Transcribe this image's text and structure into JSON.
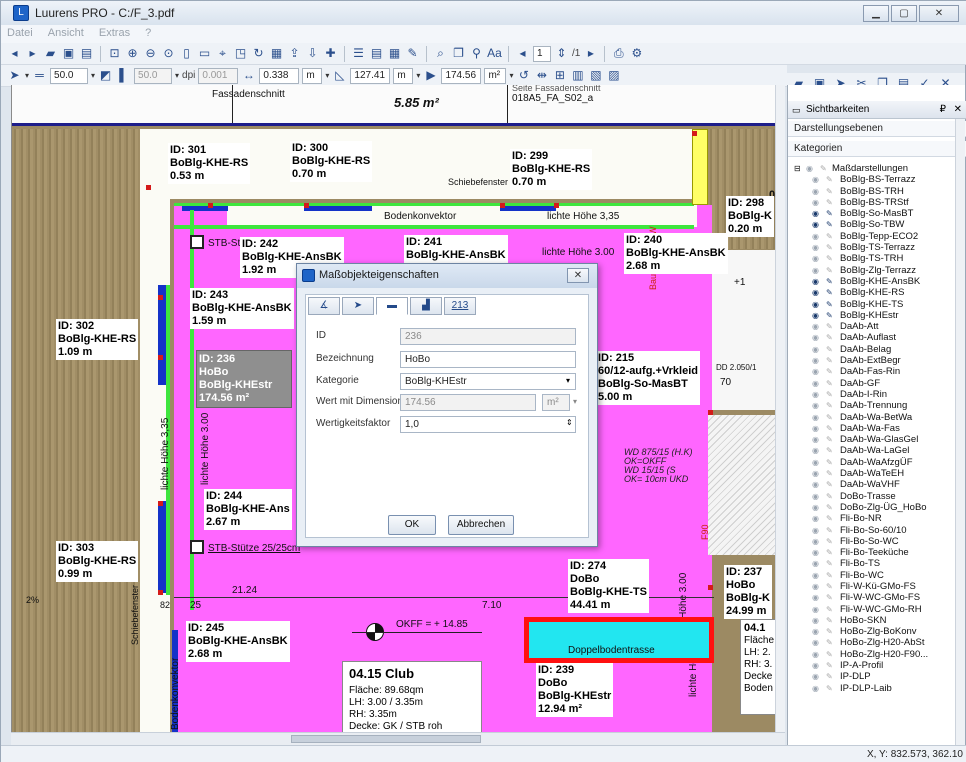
{
  "window": {
    "title": "Luurens PRO - C:/F_3.pdf",
    "min_icon": "window-minimize-icon",
    "max_icon": "window-maximize-icon",
    "close_icon": "window-close-icon"
  },
  "menu": [
    "Datei",
    "Ansicht",
    "Extras",
    "?"
  ],
  "toolbar2": {
    "page_value": "1",
    "page_total": "/1"
  },
  "toolbar3": {
    "linewidth": "50.0",
    "linewidth2": "50.0",
    "dpi_label": "dpi",
    "dpi_value": "0.001",
    "length_value": "0.338",
    "length_unit": "m",
    "area_value": "127.41",
    "area_unit": "m",
    "total_value": "174.56",
    "total_unit": "m²"
  },
  "drawing": {
    "header_left": "Fassadenschnitt",
    "header_mid": "5.85 m²",
    "header_right": "018A5_FA_S02_a",
    "header_right_top": "Seite Fassadenschnitt",
    "labels": [
      {
        "id": "ID: 301",
        "name": "BoBlg-KHE-RS",
        "value": "0.53 m"
      },
      {
        "id": "ID: 300",
        "name": "BoBlg-KHE-RS",
        "value": "0.70 m"
      },
      {
        "id": "ID: 299",
        "name": "BoBlg-KHE-RS",
        "value": "0.70 m"
      },
      {
        "id": "ID: 298",
        "name": "BoBlg-K",
        "value": "0.20 m"
      },
      {
        "id": "ID: 242",
        "name": "BoBlg-KHE-AnsBK",
        "value": "1.92 m"
      },
      {
        "id": "ID: 241",
        "name": "BoBlg-KHE-AnsBK",
        "value": ""
      },
      {
        "id": "ID: 240",
        "name": "BoBlg-KHE-AnsBK",
        "value": "2.68 m"
      },
      {
        "id": "ID: 243",
        "name": "BoBlg-KHE-AnsBK",
        "value": "1.59 m"
      },
      {
        "id": "ID: 302",
        "name": "BoBlg-KHE-RS",
        "value": "1.09 m"
      },
      {
        "id": "ID: 215",
        "name": "60/12-aufg.+Vrkleid",
        "name2": "BoBlg-So-MasBT",
        "value": "5.00 m"
      },
      {
        "id": "ID: 244",
        "name": "BoBlg-KHE-Ans",
        "value": "2.67 m"
      },
      {
        "id": "ID: 303",
        "name": "BoBlg-KHE-RS",
        "value": "0.99 m"
      },
      {
        "id": "ID: 274",
        "name": "DoBo",
        "name2": "BoBlg-KHE-TS",
        "value": "44.41 m"
      },
      {
        "id": "ID: 237",
        "name": "HoBo",
        "name2": "BoBlg-K",
        "value": "24.99 m"
      },
      {
        "id": "ID: 245",
        "name": "BoBlg-KHE-AnsBK",
        "value": "2.68 m"
      },
      {
        "id": "ID: 239",
        "name": "DoBo",
        "name2": "BoBlg-KHEstr",
        "value": "12.94 m²"
      }
    ],
    "selected_label": {
      "id": "ID: 236",
      "name": "HoBo",
      "name2": "BoBlg-KHEstr",
      "value": "174.56 m²"
    },
    "texts": {
      "bodenkonvektor": "Bodenkonvektor",
      "lichte_hoehe_335": "lichte Höhe 3,35",
      "lichte_hoehe_300": "lichte Höhe 3.00",
      "stb_stuetze": "STB-Stütze 25/25cm",
      "stb_s": "STB-St",
      "schiebefenster": "Schiebefenster",
      "doppelboden": "Doppelbodentrasse",
      "okff": "OKFF = + 14.85",
      "dim_2124": "21.24",
      "dim_710": "7.10",
      "dim_25": "25",
      "dim_82": "82",
      "dim_2pct": "2%",
      "dim_70": "70",
      "dim_41": "+1",
      "dd": "DD 2.050/1",
      "lichte_hoehe_280": "lichte Höhe 2.80",
      "wd_note1": "WD 875/15 (H.K)",
      "wd_note2": "OK=OKFF",
      "wd_note3": "WD 15/15 (S",
      "wd_note4": "OK= 10cm UKD",
      "f90": "F90",
      "bauartner": "Bauarteiner BW",
      "room_041": "04.1",
      "flaeche_short": "Fläche",
      "lh_short": "LH: 2.",
      "rh_short": "RH: 3.",
      "decke_short": "Decke",
      "boden_short": "Boden",
      "dachs": "0"
    },
    "room": {
      "title": "04.15  Club",
      "flaeche": "Fläche: 89.68qm",
      "lh": "LH: 3.00 / 3.35m",
      "rh": "RH: 3.35m",
      "decke": "Decke: GK / STB roh"
    }
  },
  "dialog": {
    "title": "Maßobjekteigenschaften",
    "tabs": [
      "angle-icon",
      "brush-icon",
      "line-icon",
      "chart-icon",
      "213"
    ],
    "fields": {
      "id_label": "ID",
      "id_value": "236",
      "bez_label": "Bezeichnung",
      "bez_value": "HoBo",
      "kat_label": "Kategorie",
      "kat_value": "BoBlg-KHEstr",
      "wert_label": "Wert mit Dimension",
      "wert_value": "174.56",
      "wert_unit": "m²",
      "wf_label": "Wertigkeitsfaktor",
      "wf_value": "1,0"
    },
    "ok": "OK",
    "cancel": "Abbrechen"
  },
  "panel": {
    "title": "Sichtbarkeiten",
    "section1": "Darstellungsebenen",
    "section2": "Kategorien",
    "root": "Maßdarstellungen",
    "items": [
      {
        "name": "BoBlg-BS-Terrazz",
        "on": false
      },
      {
        "name": "BoBlg-BS-TRH",
        "on": false
      },
      {
        "name": "BoBlg-BS-TRStf",
        "on": false
      },
      {
        "name": "BoBlg-So-MasBT",
        "on": true
      },
      {
        "name": "BoBlg-So-TBW",
        "on": true
      },
      {
        "name": "BoBlg-Tepp-ECO2",
        "on": false
      },
      {
        "name": "BoBlg-TS-Terrazz",
        "on": false
      },
      {
        "name": "BoBlg-TS-TRH",
        "on": false
      },
      {
        "name": "BoBlg-Zlg-Terrazz",
        "on": false
      },
      {
        "name": "BoBlg-KHE-AnsBK",
        "on": true
      },
      {
        "name": "BoBlg-KHE-RS",
        "on": true
      },
      {
        "name": "BoBlg-KHE-TS",
        "on": true
      },
      {
        "name": "BoBlg-KHEstr",
        "on": true
      },
      {
        "name": "DaAb-Att",
        "on": false
      },
      {
        "name": "DaAb-Auflast",
        "on": false
      },
      {
        "name": "DaAb-Belag",
        "on": false
      },
      {
        "name": "DaAb-ExtBegr",
        "on": false
      },
      {
        "name": "DaAb-Fas-Rin",
        "on": false
      },
      {
        "name": "DaAb-GF",
        "on": false
      },
      {
        "name": "DaAb-I-Rin",
        "on": false
      },
      {
        "name": "DaAb-Trennung",
        "on": false
      },
      {
        "name": "DaAb-Wa-BetWa",
        "on": false
      },
      {
        "name": "DaAb-Wa-Fas",
        "on": false
      },
      {
        "name": "DaAb-Wa-GlasGel",
        "on": false
      },
      {
        "name": "DaAb-Wa-LaGel",
        "on": false
      },
      {
        "name": "DaAb-WaAfzgÜF",
        "on": false
      },
      {
        "name": "DaAb-WaTeEH",
        "on": false
      },
      {
        "name": "DaAb-WaVHF",
        "on": false
      },
      {
        "name": "DoBo-Trasse",
        "on": false
      },
      {
        "name": "DoBo-Zlg-ÜG_HoBo",
        "on": false
      },
      {
        "name": "Fli-Bo-NR",
        "on": false
      },
      {
        "name": "Fli-Bo-So-60/10",
        "on": false
      },
      {
        "name": "Fli-Bo-So-WC",
        "on": false
      },
      {
        "name": "Fli-Bo-Teeküche",
        "on": false
      },
      {
        "name": "Fli-Bo-TS",
        "on": false
      },
      {
        "name": "Fli-Bo-WC",
        "on": false
      },
      {
        "name": "Fli-W-Kü-GMo-FS",
        "on": false
      },
      {
        "name": "Fli-W-WC-GMo-FS",
        "on": false
      },
      {
        "name": "Fli-W-WC-GMo-RH",
        "on": false
      },
      {
        "name": "HoBo-SKN",
        "on": false
      },
      {
        "name": "HoBo-Zlg-BoKonv",
        "on": false
      },
      {
        "name": "HoBo-Zlg-H20-AbSt",
        "on": false
      },
      {
        "name": "HoBo-Zlg-H20-F90...",
        "on": false
      },
      {
        "name": "IP-A-Profil",
        "on": false
      },
      {
        "name": "IP-DLP",
        "on": false
      },
      {
        "name": "IP-DLP-Laib",
        "on": false
      }
    ]
  },
  "status": {
    "coords": "X, Y: 832.573, 362.10"
  },
  "colors": {
    "pink": "#ff66ff",
    "blue": "#1432c8",
    "green": "#3ee63e",
    "cyan": "#22e6f0",
    "red": "#ff1010"
  }
}
